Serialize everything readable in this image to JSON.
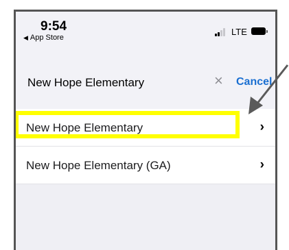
{
  "status_bar": {
    "time": "9:54",
    "back_label": "App Store",
    "network": "LTE"
  },
  "search": {
    "value": "New Hope Elementary",
    "cancel_label": "Cancel"
  },
  "results": [
    {
      "label": "New Hope Elementary",
      "highlighted": true
    },
    {
      "label": "New Hope Elementary (GA)",
      "highlighted": false
    }
  ],
  "annotation": {
    "highlight_color": "#ffff00",
    "arrow_color": "#5a5a5a"
  },
  "colors": {
    "accent": "#1a6fd1"
  }
}
